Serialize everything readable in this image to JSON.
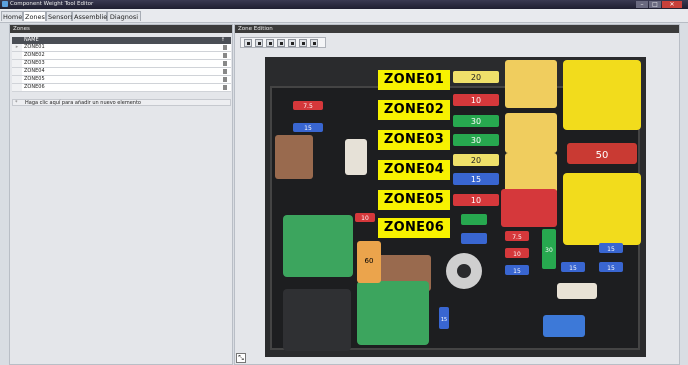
{
  "window": {
    "title": "Component Weight Tool Editor",
    "minimize": "–",
    "maximize": "□",
    "close": "✕"
  },
  "tabs": [
    "Home",
    "Zones",
    "Sensors",
    "Assemblies",
    "Diagnosi"
  ],
  "active_tab": "Zones",
  "zones_panel": {
    "title": "Zones",
    "columns": {
      "name": "NAME",
      "action": "↑"
    },
    "rows": [
      {
        "name": "ZONE01",
        "selector": "▸"
      },
      {
        "name": "ZONE02",
        "selector": ""
      },
      {
        "name": "ZONE03",
        "selector": ""
      },
      {
        "name": "ZONE04",
        "selector": ""
      },
      {
        "name": "ZONE05",
        "selector": ""
      },
      {
        "name": "ZONE06",
        "selector": ""
      }
    ],
    "add_row": {
      "marker": "*",
      "text": "Haga clic aquí para añadir un nuevo elemento"
    }
  },
  "edition_panel": {
    "title": "Zone Edition",
    "toolbar": [
      "align-left-icon",
      "align-center-icon",
      "align-right-icon",
      "distribute-horizontal-icon",
      "align-bottom-icon",
      "align-top-icon",
      "move-icon"
    ],
    "resize_glyph": "⤡"
  },
  "zone_labels": [
    "ZONE01",
    "ZONE02",
    "ZONE03",
    "ZONE04",
    "ZONE05",
    "ZONE06"
  ],
  "fuse_labels": {
    "f20a": "20",
    "f10a": "10",
    "f30a": "30",
    "f30b": "30",
    "f20b": "20",
    "f15a": "15",
    "f10b": "10",
    "f50": "50",
    "f7_5a": "7.5",
    "f15b": "15",
    "f10c": "10",
    "f7_5b": "7.5",
    "f10d": "10",
    "f15c": "15",
    "f30c": "30",
    "f15d": "15",
    "f15e": "15",
    "f15f": "15",
    "f60": "60",
    "f10e": "10",
    "f15g": "15"
  },
  "colors": {
    "zone_highlight": "#f7f200",
    "fuse_yellow": "#efe06a",
    "fuse_red": "#d5383b",
    "fuse_green": "#27a84f",
    "fuse_blue": "#3966d1",
    "relay_green": "#3ca55e",
    "relay_brown": "#996a4e",
    "relay_yellow": "#f2dc1c"
  }
}
